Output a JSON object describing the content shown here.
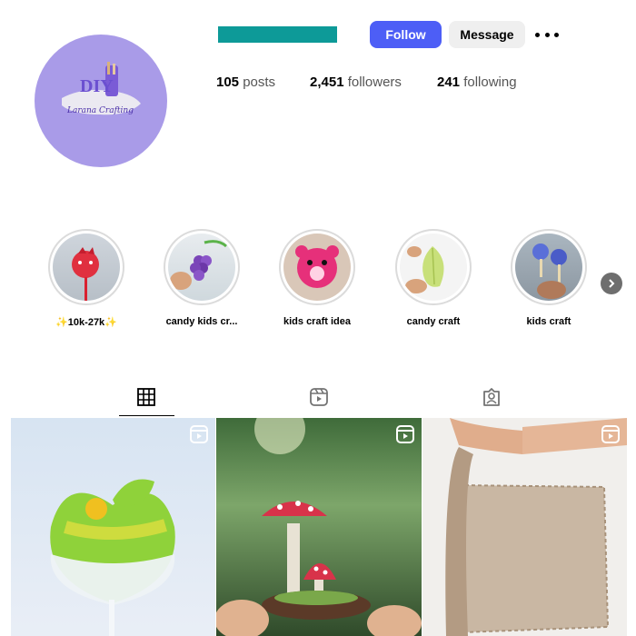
{
  "profile": {
    "avatar_logo_text": "DIY",
    "avatar_logo_subtext": "Larana Crafting",
    "username_bar_color": "#0d9a98"
  },
  "actions": {
    "follow_label": "Follow",
    "message_label": "Message",
    "follow_color": "#4d5ef6"
  },
  "stats": {
    "posts_count": "105",
    "posts_label": "posts",
    "followers_count": "2,451",
    "followers_label": "followers",
    "following_count": "241",
    "following_label": "following"
  },
  "highlights": [
    {
      "label": "✨10k-27k✨"
    },
    {
      "label": "candy kids cr..."
    },
    {
      "label": "kids craft idea"
    },
    {
      "label": "candy craft"
    },
    {
      "label": "kids craft"
    }
  ],
  "tabs": [
    {
      "icon": "grid-icon",
      "active": true
    },
    {
      "icon": "reels-icon",
      "active": false
    },
    {
      "icon": "tagged-icon",
      "active": false
    }
  ],
  "posts": [
    {
      "subject": "green apple candy lollipop",
      "reel": true
    },
    {
      "subject": "mushroom miniature",
      "reel": true
    },
    {
      "subject": "clay slab",
      "reel": true
    }
  ]
}
